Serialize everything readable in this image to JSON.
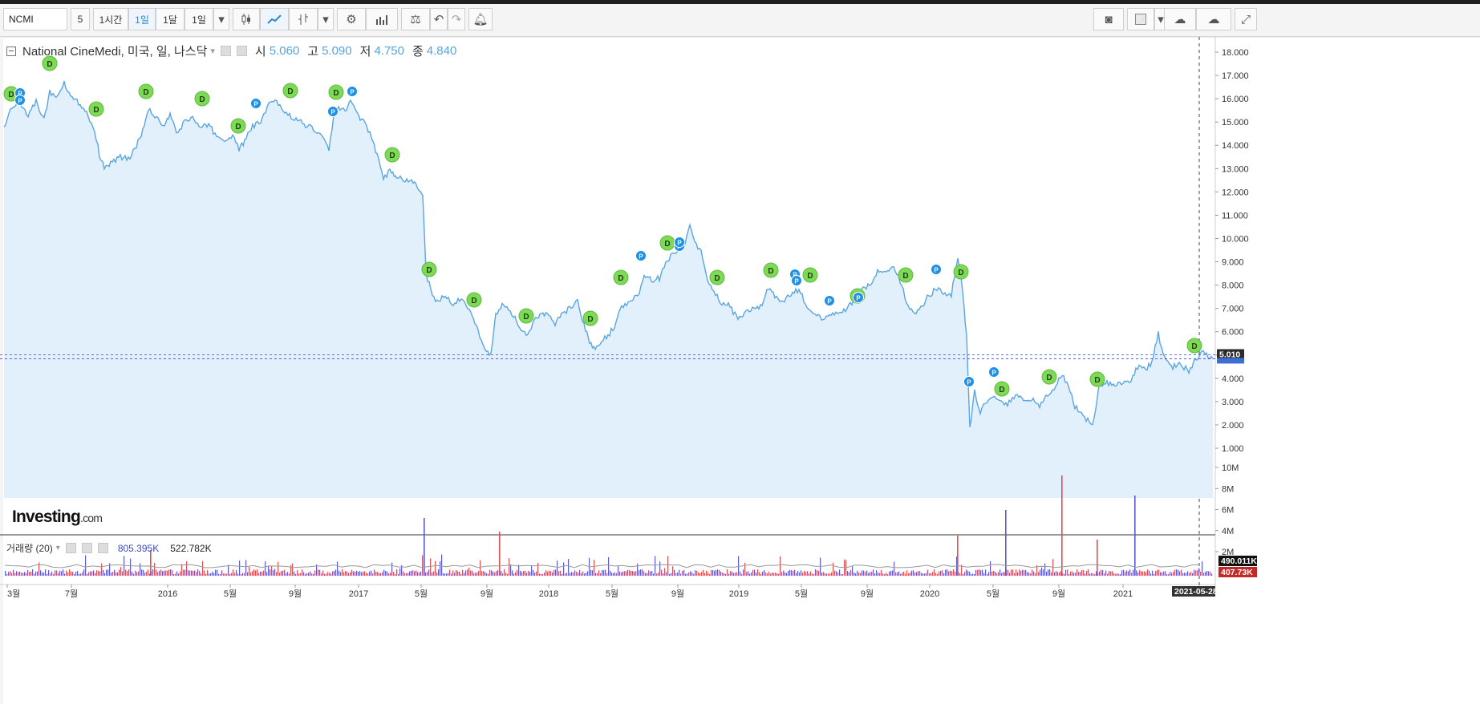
{
  "toolbar": {
    "symbol": "NCMI",
    "interval_value": "5",
    "btn_1h": "1시간",
    "btn_1d": "1일",
    "btn_1m": "1달",
    "btn_range": "1일"
  },
  "legend": {
    "title": "National CineMedi, 미국, 일, 나스닥",
    "open_label": "시",
    "open": "5.060",
    "high_label": "고",
    "high": "5.090",
    "low_label": "저",
    "low": "4.750",
    "close_label": "종",
    "close": "4.840"
  },
  "volume_legend": {
    "label": "거래량 (20)",
    "v1": "805.395K",
    "v2": "522.782K"
  },
  "logo": {
    "main": "Investing",
    "suffix": ".com"
  },
  "price_axis": {
    "ticks": [
      "18.000",
      "17.000",
      "16.000",
      "15.000",
      "14.000",
      "13.000",
      "12.000",
      "11.000",
      "10.000",
      "9.000",
      "8.000",
      "7.000",
      "6.000",
      "5.000",
      "4.000",
      "3.000",
      "2.000",
      "1.000"
    ],
    "current_price": "5.010"
  },
  "volume_axis": {
    "ticks": [
      "10M",
      "8M",
      "6M",
      "4M",
      "2M"
    ],
    "badge_dark": "490.011K",
    "badge_red": "407.73K"
  },
  "time_axis": {
    "labels": [
      "3월",
      "7월",
      "2016",
      "5월",
      "9월",
      "2017",
      "5월",
      "9월",
      "2018",
      "5월",
      "9월",
      "2019",
      "5월",
      "9월",
      "2020",
      "5월",
      "9월",
      "2021"
    ],
    "cursor_date": "2021-05-28"
  },
  "event_markers": {
    "dividend": "D",
    "split": "P"
  },
  "colors": {
    "line": "#5aa5e2",
    "area": "#e1f0fa",
    "dividend": "#7ed957",
    "split": "#1e90e6",
    "vol_up": "#e05050",
    "vol_down": "#5b5bd6"
  }
}
